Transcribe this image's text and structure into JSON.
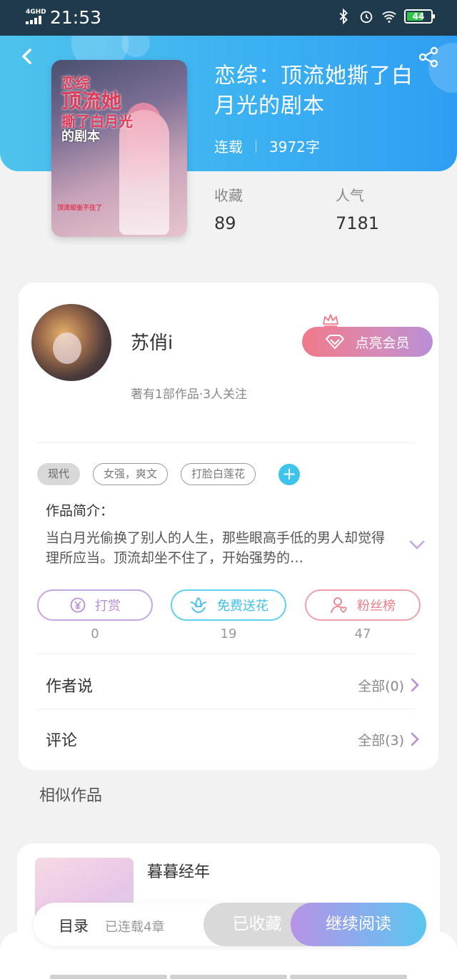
{
  "status_bar": {
    "network": "4GHD",
    "time": "21:53",
    "battery": "44"
  },
  "book": {
    "cover_text": [
      "恋综",
      "顶流她",
      "撕了白月光",
      "的剧本"
    ],
    "cover_small": "顶流却坐不住了",
    "title": "恋综：顶流她撕了白月光的剧本",
    "status": "连载",
    "word_count": "3972字",
    "favorites_label": "收藏",
    "favorites_value": "89",
    "popularity_label": "人气",
    "popularity_value": "7181"
  },
  "author": {
    "name": "苏俏i",
    "info": "著有1部作品·3人关注",
    "vip_label": "点亮会员"
  },
  "tags": [
    "现代",
    "女强，爽文",
    "打脸白莲花"
  ],
  "intro": {
    "title": "作品简介：",
    "text": "当白月光偷换了别人的人生，那些眼高手低的男人却觉得理所应当。顶流却坐不住了，开始强势的…"
  },
  "actions": [
    {
      "label": "打赏",
      "count": "0",
      "icon": "coin-icon"
    },
    {
      "label": "免费送花",
      "count": "19",
      "icon": "flower-icon"
    },
    {
      "label": "粉丝榜",
      "count": "47",
      "icon": "user-icon"
    }
  ],
  "author_say": {
    "label": "作者说",
    "link": "全部(0)"
  },
  "comments": {
    "label": "评论",
    "link": "全部(3)"
  },
  "similar": {
    "title": "相似作品",
    "items": [
      {
        "title": "暮暮经年"
      }
    ]
  },
  "bottom_bar": {
    "toc_label": "目录",
    "progress": "已连载4章",
    "favorited_label": "已收藏",
    "continue_label": "继续阅读"
  },
  "colors": {
    "header_start": "#4ec3ec",
    "header_end": "#2f9ef2",
    "tip": "#b98fd4",
    "flower": "#3ec1e6",
    "fans": "#ec7f8a"
  }
}
